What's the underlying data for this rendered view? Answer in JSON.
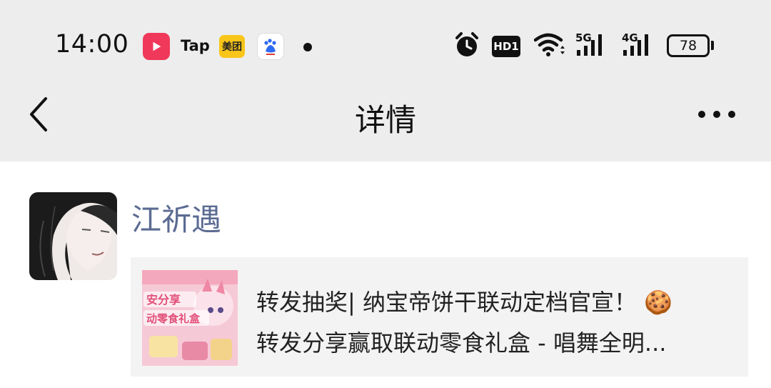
{
  "status_bar": {
    "time": "14:00",
    "apps": [
      {
        "name": "video-app-icon",
        "label": ""
      },
      {
        "name": "tap-app-icon",
        "label": "Tap"
      },
      {
        "name": "meituan-app-icon",
        "label": "美团"
      },
      {
        "name": "baidu-app-icon",
        "label": "du"
      }
    ],
    "hd_label": "HD1",
    "network_5g": "5G",
    "network_4g": "4G",
    "battery": "78"
  },
  "nav": {
    "title": "详情",
    "back_icon": "chevron-left-icon",
    "more_icon": "more-horizontal-icon"
  },
  "post": {
    "author": "江祈遇",
    "card": {
      "line1": "转发抽奖| 纳宝帝饼干联动定档官宣！ 🍪",
      "line2": "转发分享赢取联动零食礼盒 - 唱舞全明...",
      "thumb_text": [
        "安分享",
        "动零食礼盒"
      ]
    }
  },
  "colors": {
    "header_bg": "#ededed",
    "author_name": "#5b6b92",
    "card_bg": "#f3f3f3"
  }
}
